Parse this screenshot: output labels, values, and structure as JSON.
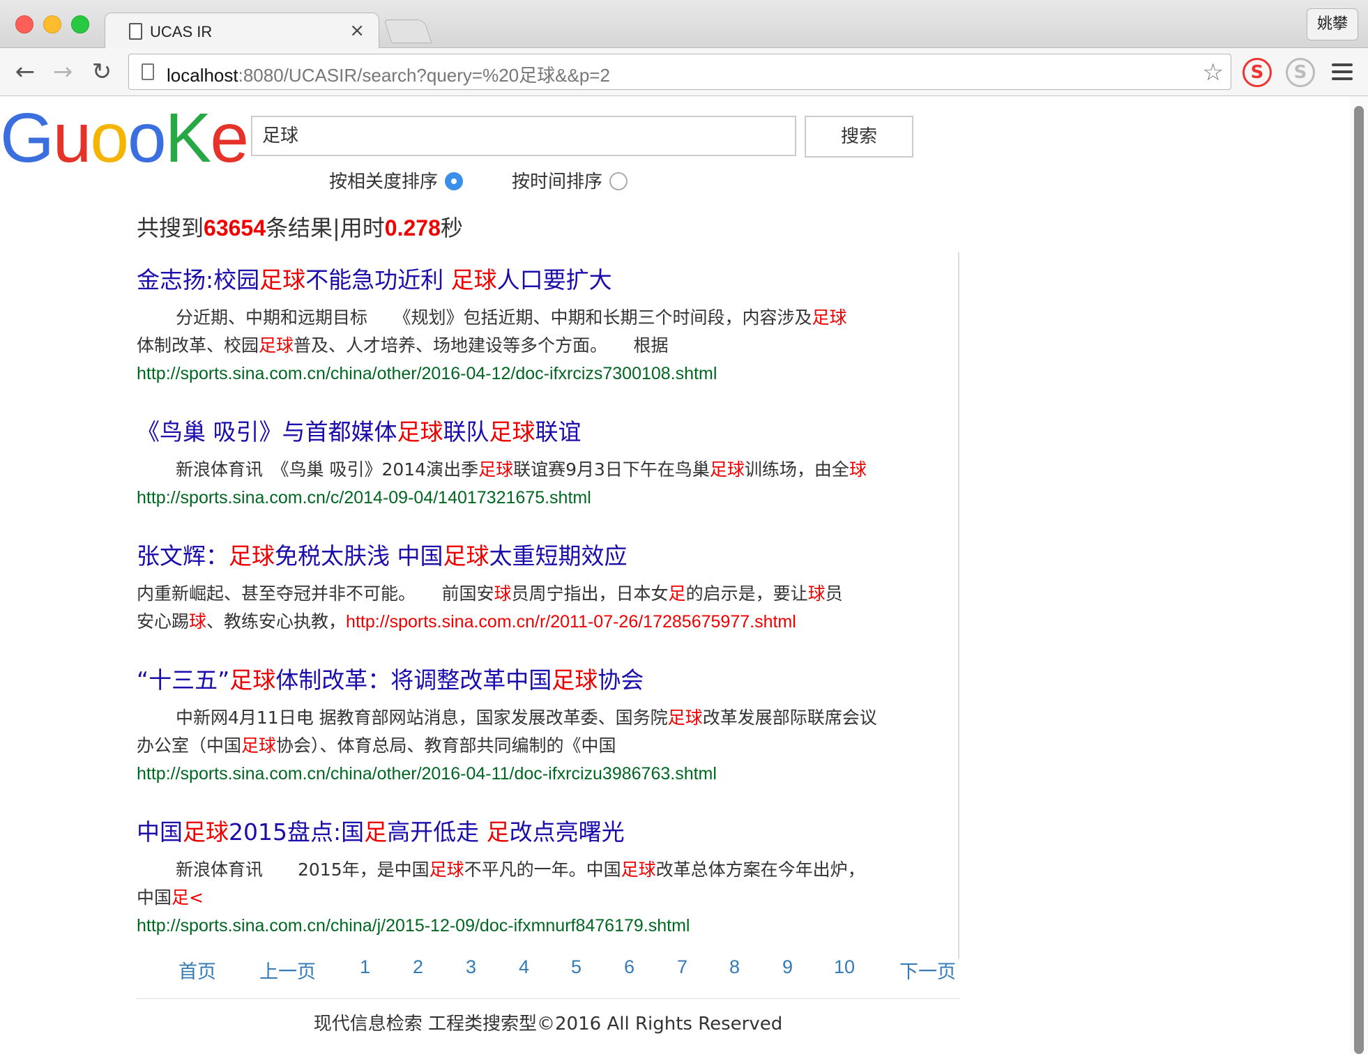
{
  "browser": {
    "tab_title": "UCAS IR",
    "tab_close": "×",
    "profile_name": "姚攀",
    "url_host": "localhost",
    "url_rest": ":8080/UCASIR/search?query=%20足球&&p=2",
    "ext1_glyph": "S",
    "ext2_glyph": "S"
  },
  "logo": {
    "letters": [
      "G",
      "u",
      "o",
      "o",
      "K",
      "e"
    ],
    "colors": [
      "#3b6fe0",
      "#e53329",
      "#f5b400",
      "#3b6fe0",
      "#28a745",
      "#e53329"
    ]
  },
  "search": {
    "query": "足球",
    "button_label": "搜索",
    "sort_relevance_label": "按相关度排序",
    "sort_time_label": "按时间排序",
    "selected_sort": "relevance"
  },
  "stats": {
    "prefix": "共搜到",
    "count": "63654",
    "middle": "条结果|用时",
    "time": "0.278",
    "suffix": "秒"
  },
  "results": [
    {
      "title": [
        {
          "t": "金志扬:校园",
          "h": false
        },
        {
          "t": "足球",
          "h": true
        },
        {
          "t": "不能急功近利 ",
          "h": false
        },
        {
          "t": "足球",
          "h": true
        },
        {
          "t": "人口要扩大",
          "h": false
        }
      ],
      "snippet_lines": [
        [
          {
            "t": "分近期、中期和远期目标　　《规划》包括近期、中期和长期三个时间段，内容涉及",
            "h": false
          },
          {
            "t": "足球",
            "h": true
          }
        ],
        [
          {
            "t": "体制改革、校园",
            "h": false
          },
          {
            "t": "足球",
            "h": true
          },
          {
            "t": "普及、人才培养、场地建设等多个方面。　　根据",
            "h": false
          }
        ]
      ],
      "url": "http://sports.sina.com.cn/china/other/2016-04-12/doc-ifxrcizs7300108.shtml"
    },
    {
      "title": [
        {
          "t": "《鸟巢 吸引》与首都媒体",
          "h": false
        },
        {
          "t": "足球",
          "h": true
        },
        {
          "t": "联队",
          "h": false
        },
        {
          "t": "足球",
          "h": true
        },
        {
          "t": "联谊",
          "h": false
        }
      ],
      "snippet_lines": [
        [
          {
            "t": "新浪体育讯　《鸟巢 吸引》2014演出季",
            "h": false
          },
          {
            "t": "足球",
            "h": true
          },
          {
            "t": "联谊赛9月3日下午在鸟巢",
            "h": false
          },
          {
            "t": "足球",
            "h": true
          },
          {
            "t": "训练场，由全",
            "h": false
          },
          {
            "t": "球",
            "h": true
          }
        ]
      ],
      "url": "http://sports.sina.com.cn/c/2014-09-04/14017321675.shtml"
    },
    {
      "title": [
        {
          "t": "张文辉：",
          "h": false
        },
        {
          "t": "足球",
          "h": true
        },
        {
          "t": "免税太肤浅 中国",
          "h": false
        },
        {
          "t": "足球",
          "h": true
        },
        {
          "t": "太重短期效应",
          "h": false
        }
      ],
      "snippet_lines": [
        [
          {
            "t": "内重新崛起、甚至夺冠并非不可能。　　前国安",
            "h": false
          },
          {
            "t": "球",
            "h": true
          },
          {
            "t": "员周宁指出，日本女",
            "h": false
          },
          {
            "t": "足",
            "h": true
          },
          {
            "t": "的启示是，要让",
            "h": false
          },
          {
            "t": "球",
            "h": true
          },
          {
            "t": "员",
            "h": false
          }
        ],
        [
          {
            "t": "安心踢",
            "h": false
          },
          {
            "t": "球",
            "h": true
          },
          {
            "t": "、教练安心执教，",
            "h": false
          }
        ]
      ],
      "inline_url": "http://sports.sina.com.cn/r/2011-07-26/17285675977.shtml"
    },
    {
      "title": [
        {
          "t": "“十三五”",
          "h": false
        },
        {
          "t": "足球",
          "h": true
        },
        {
          "t": "体制改革：将调整改革中国",
          "h": false
        },
        {
          "t": "足球",
          "h": true
        },
        {
          "t": "协会",
          "h": false
        }
      ],
      "snippet_lines": [
        [
          {
            "t": "中新网4月11日电 据教育部网站消息，国家发展改革委、国务院",
            "h": false
          },
          {
            "t": "足球",
            "h": true
          },
          {
            "t": "改革发展部际联席会议",
            "h": false
          }
        ],
        [
          {
            "t": "办公室（中国",
            "h": false
          },
          {
            "t": "足球",
            "h": true
          },
          {
            "t": "协会）、体育总局、教育部共同编制的《中国",
            "h": false
          }
        ]
      ],
      "url": "http://sports.sina.com.cn/china/other/2016-04-11/doc-ifxrcizu3986763.shtml"
    },
    {
      "title": [
        {
          "t": "中国",
          "h": false
        },
        {
          "t": "足球",
          "h": true
        },
        {
          "t": "2015盘点:国",
          "h": false
        },
        {
          "t": "足",
          "h": true
        },
        {
          "t": "高开低走 ",
          "h": false
        },
        {
          "t": "足",
          "h": true
        },
        {
          "t": "改点亮曙光",
          "h": false
        }
      ],
      "snippet_lines": [
        [
          {
            "t": "新浪体育讯　　2015年，是中国",
            "h": false
          },
          {
            "t": "足球",
            "h": true
          },
          {
            "t": "不平凡的一年。中国",
            "h": false
          },
          {
            "t": "足球",
            "h": true
          },
          {
            "t": "改革总体方案在今年出炉，",
            "h": false
          }
        ],
        [
          {
            "t": "中国",
            "h": false
          },
          {
            "t": "足<",
            "h": true
          }
        ]
      ],
      "url": "http://sports.sina.com.cn/china/j/2015-12-09/doc-ifxmnurf8476179.shtml"
    }
  ],
  "pagination": {
    "first": "首页",
    "prev": "上一页",
    "pages": [
      "1",
      "2",
      "3",
      "4",
      "5",
      "6",
      "7",
      "8",
      "9",
      "10"
    ],
    "next": "下一页"
  },
  "footer": {
    "text": "现代信息检索 工程类搜索型©2016 All Rights Reserved"
  }
}
